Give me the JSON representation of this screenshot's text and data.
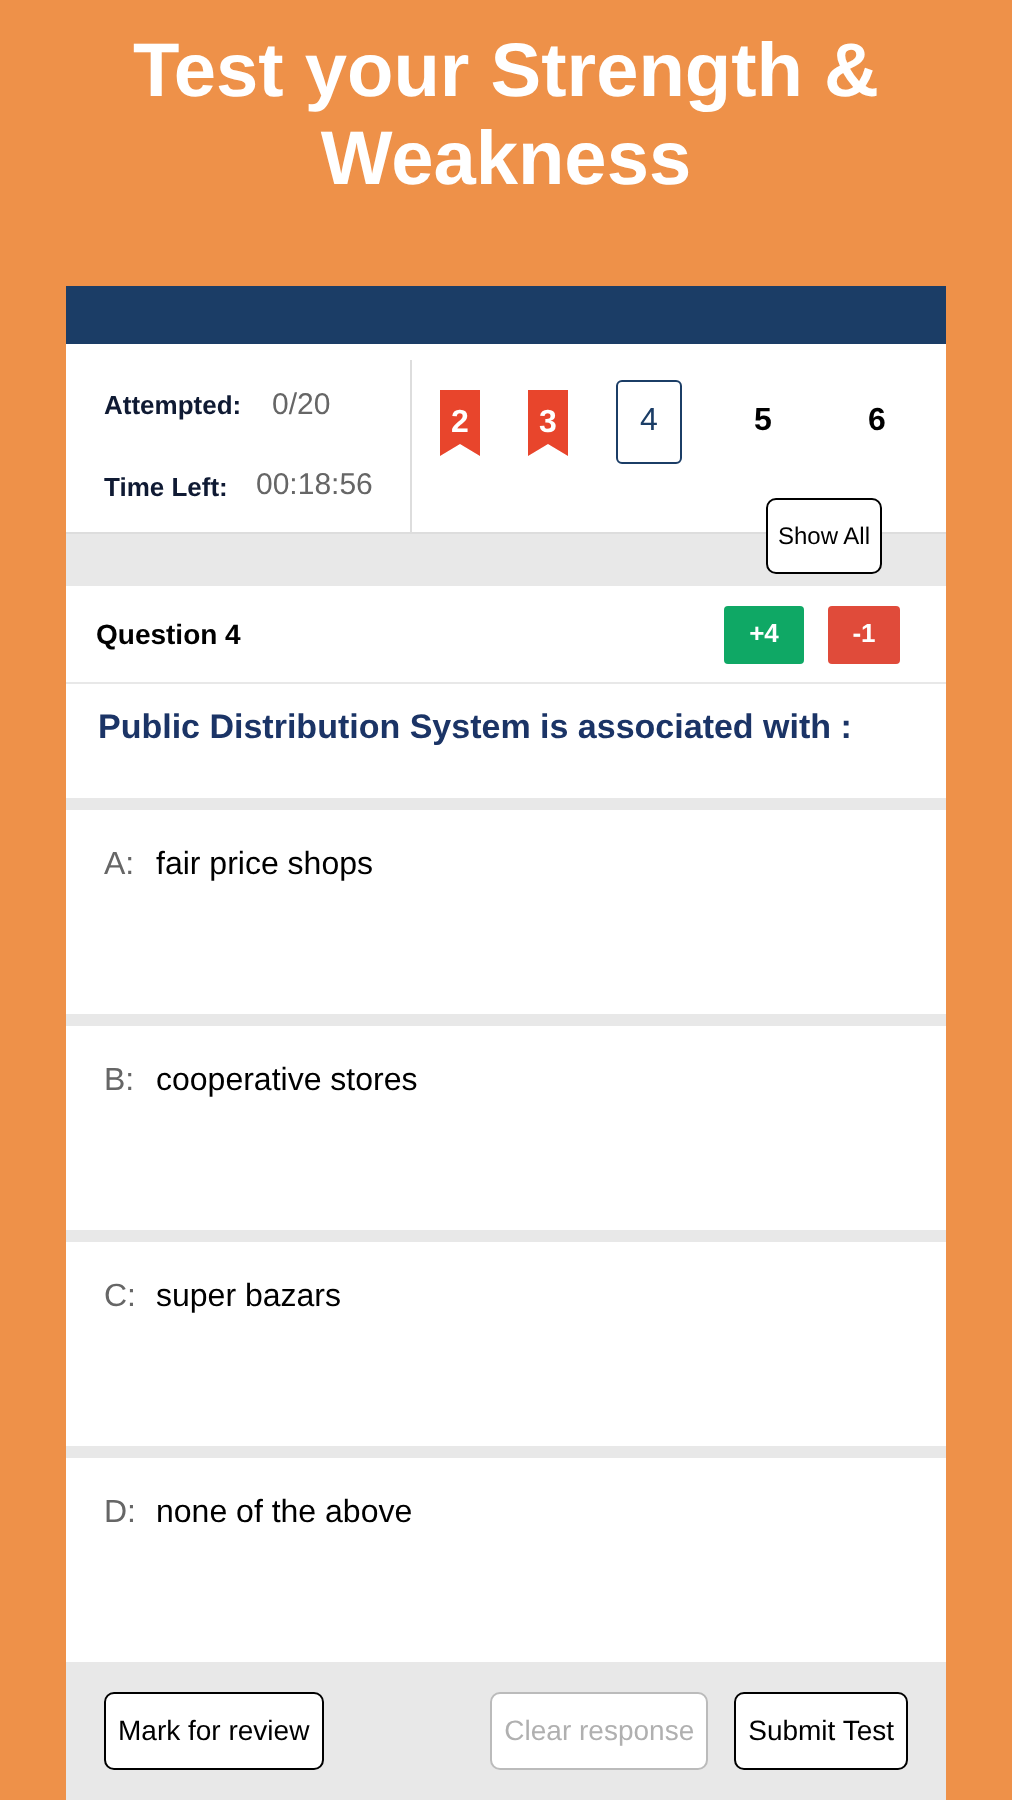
{
  "headline": "Test your Strength & Weakness",
  "status": {
    "attempted_label": "Attempted:",
    "attempted_value": "0/20",
    "time_label": "Time Left:",
    "time_value": "00:18:56"
  },
  "palette": [
    {
      "label": "2",
      "marked": true,
      "selected": false
    },
    {
      "label": "3",
      "marked": true,
      "selected": false
    },
    {
      "label": "4",
      "marked": false,
      "selected": true
    },
    {
      "label": "5",
      "marked": false,
      "selected": false
    },
    {
      "label": "6",
      "marked": false,
      "selected": false
    }
  ],
  "show_all": "Show All",
  "question": {
    "number": "Question 4",
    "positive": "+4",
    "negative": "-1",
    "text": "Public Distribution System is associated with :"
  },
  "options": [
    {
      "letter": "A:",
      "text": "fair price shops",
      "selected": false
    },
    {
      "letter": "B:",
      "text": "cooperative stores",
      "selected": false
    },
    {
      "letter": "C:",
      "text": "super bazars",
      "selected": false
    },
    {
      "letter": "D:",
      "text": "none of the above",
      "selected": false
    }
  ],
  "buttons": [
    {
      "label": "Mark for review",
      "disabled": false
    },
    {
      "label": "Clear response",
      "disabled": true
    },
    {
      "label": "Submit Test",
      "disabled": false
    }
  ]
}
